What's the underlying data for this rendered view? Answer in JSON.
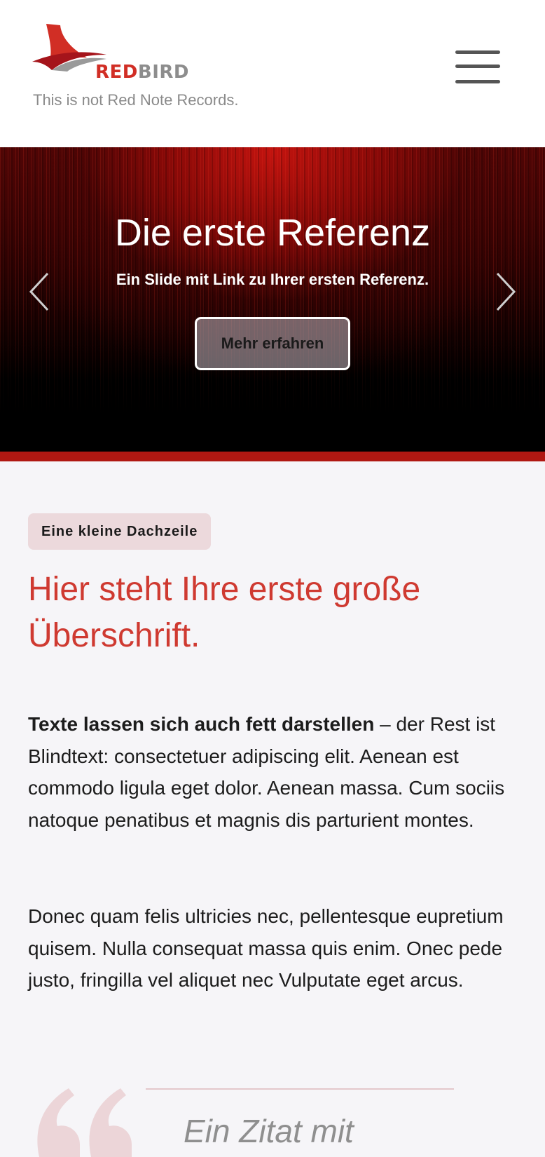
{
  "header": {
    "logo": {
      "word_red": "RED",
      "word_grey": "BIRD",
      "icon": "shark-fin-logo",
      "colors": {
        "red": "#d12e25",
        "dark_red": "#a5141b",
        "grey": "#8d8d8d"
      }
    },
    "tagline": "This is not Red Note Records.",
    "menu_icon": "hamburger-menu-icon"
  },
  "hero": {
    "title": "Die erste Referenz",
    "subtitle": "Ein Slide mit Link zu Ihrer ersten Referenz.",
    "button_label": "Mehr erfahren",
    "prev_icon": "chevron-left-icon",
    "next_icon": "chevron-right-icon",
    "accent_bar_color": "#b01812"
  },
  "main": {
    "kicker": "Eine kleine Dachzeile",
    "headline": "Hier steht Ihre erste große Überschrift.",
    "paragraph_1": {
      "bold": "Texte lassen sich auch fett darstellen",
      "rest": " – der Rest ist Blindtext: consectetuer adipiscing elit. Aenean est commodo ligula eget dolor. Aenean massa. Cum sociis natoque penatibus et magnis dis parturient montes."
    },
    "paragraph_2": "Donec quam felis ultricies nec, pellentesque eupretium quisem. Nulla consequat massa quis enim. Onec pede justo, fringilla vel aliquet nec Vulputate eget arcus.",
    "quote": {
      "icon": "quote-mark-icon",
      "text": "Ein Zitat mit"
    },
    "colors": {
      "headline": "#cf3a31",
      "kicker_bg": "#ecd9dc",
      "page_bg": "#f6f5f8"
    }
  }
}
